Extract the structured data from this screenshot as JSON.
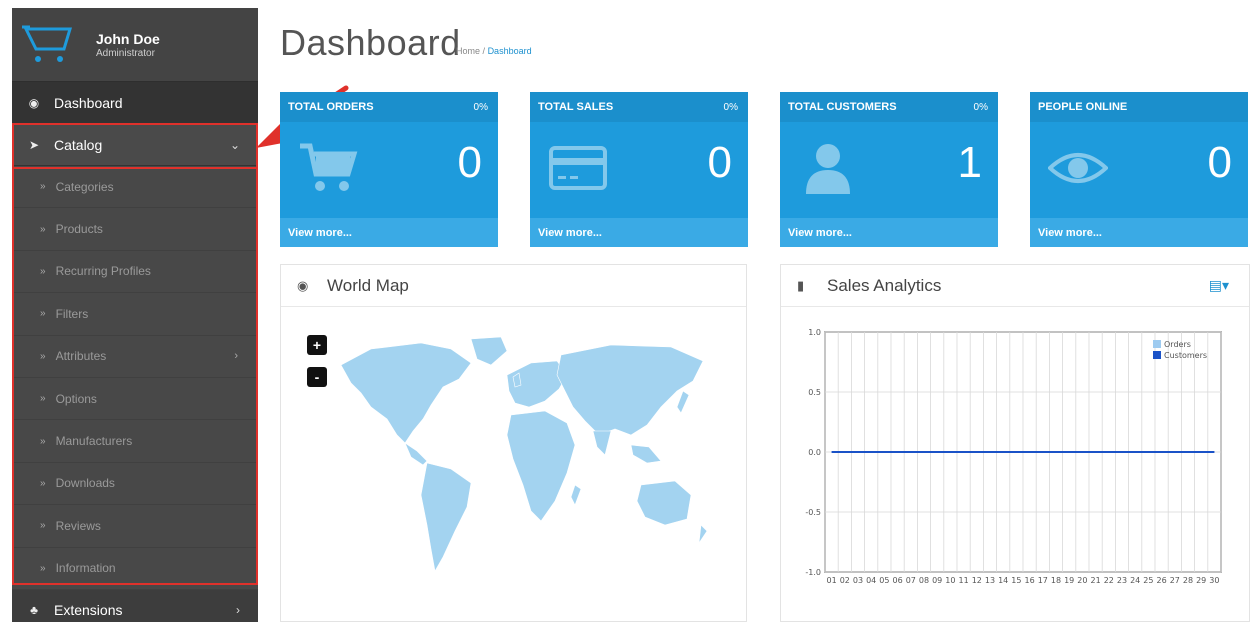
{
  "user": {
    "name": "John Doe",
    "role": "Administrator"
  },
  "sidebar": {
    "dashboard_label": "Dashboard",
    "catalog_label": "Catalog",
    "catalog_items": [
      {
        "label": "Categories",
        "has_sub": false
      },
      {
        "label": "Products",
        "has_sub": false
      },
      {
        "label": "Recurring Profiles",
        "has_sub": false
      },
      {
        "label": "Filters",
        "has_sub": false
      },
      {
        "label": "Attributes",
        "has_sub": true
      },
      {
        "label": "Options",
        "has_sub": false
      },
      {
        "label": "Manufacturers",
        "has_sub": false
      },
      {
        "label": "Downloads",
        "has_sub": false
      },
      {
        "label": "Reviews",
        "has_sub": false
      },
      {
        "label": "Information",
        "has_sub": false
      }
    ],
    "extensions_label": "Extensions"
  },
  "header": {
    "title": "Dashboard",
    "breadcrumb_home": "Home",
    "breadcrumb_sep": "/",
    "breadcrumb_current": "Dashboard"
  },
  "tiles": [
    {
      "title": "TOTAL ORDERS",
      "percent": "0%",
      "value": "0",
      "link": "View more...",
      "icon": "cart-icon"
    },
    {
      "title": "TOTAL SALES",
      "percent": "0%",
      "value": "0",
      "link": "View more...",
      "icon": "credit-card-icon"
    },
    {
      "title": "TOTAL CUSTOMERS",
      "percent": "0%",
      "value": "1",
      "link": "View more...",
      "icon": "user-icon"
    },
    {
      "title": "PEOPLE ONLINE",
      "percent": "",
      "value": "0",
      "link": "View more...",
      "icon": "eye-icon"
    }
  ],
  "world_map": {
    "title": "World Map",
    "zoom_in": "+",
    "zoom_out": "-"
  },
  "analytics": {
    "title": "Sales Analytics"
  },
  "colors": {
    "sidebar": "#3d3d3d",
    "tile": "#1e9bdc",
    "highlight": "#e0312b",
    "accent": "#1e91cf",
    "map_land": "#a3d3f0"
  },
  "chart_data": {
    "type": "line",
    "title": "",
    "x": [
      "01",
      "02",
      "03",
      "04",
      "05",
      "06",
      "07",
      "08",
      "09",
      "10",
      "11",
      "12",
      "13",
      "14",
      "15",
      "16",
      "17",
      "18",
      "19",
      "20",
      "21",
      "22",
      "23",
      "24",
      "25",
      "26",
      "27",
      "28",
      "29",
      "30"
    ],
    "series": [
      {
        "name": "Orders",
        "color": "#9ecbf0",
        "values": [
          0,
          0,
          0,
          0,
          0,
          0,
          0,
          0,
          0,
          0,
          0,
          0,
          0,
          0,
          0,
          0,
          0,
          0,
          0,
          0,
          0,
          0,
          0,
          0,
          0,
          0,
          0,
          0,
          0,
          0
        ]
      },
      {
        "name": "Customers",
        "color": "#1a52c7",
        "values": [
          0,
          0,
          0,
          0,
          0,
          0,
          0,
          0,
          0,
          0,
          0,
          0,
          0,
          0,
          0,
          0,
          0,
          0,
          0,
          0,
          0,
          0,
          0,
          0,
          0,
          0,
          0,
          0,
          0,
          0
        ]
      }
    ],
    "ylim": [
      -1.0,
      1.0
    ],
    "yticks": [
      "1.0",
      "0.5",
      "0.0",
      "-0.5",
      "-1.0"
    ],
    "grid": true,
    "legend": "top-right"
  }
}
